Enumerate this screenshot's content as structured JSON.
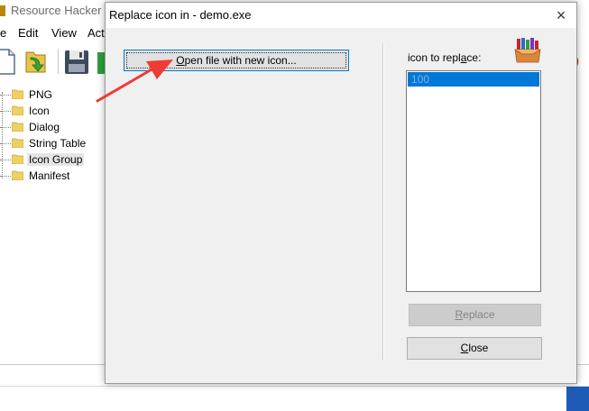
{
  "background_app": {
    "title": "Resource Hacker",
    "menu": [
      "e",
      "Edit",
      "View",
      "Act"
    ],
    "tree": [
      {
        "label": "PNG",
        "selected": false
      },
      {
        "label": "Icon",
        "selected": false
      },
      {
        "label": "Dialog",
        "selected": false
      },
      {
        "label": "String Table",
        "selected": false
      },
      {
        "label": "Icon Group",
        "selected": true
      },
      {
        "label": "Manifest",
        "selected": false
      }
    ]
  },
  "dialog": {
    "title": "Replace icon in - demo.exe",
    "close_glyph": "×",
    "open_button": {
      "label": "Open file with new icon...",
      "mnemonic": "O",
      "rest": "pen file with new icon..."
    },
    "icon_label": {
      "before": "icon to repl",
      "mnemonic": "a",
      "after": "ce:"
    },
    "icon_list": [
      "100"
    ],
    "replace_button": {
      "mnemonic": "R",
      "rest": "eplace",
      "enabled": false
    },
    "close_button": {
      "mnemonic": "C",
      "rest": "lose"
    }
  },
  "colors": {
    "accent": "#0078d7",
    "annotation_arrow": "#ef3b36"
  }
}
